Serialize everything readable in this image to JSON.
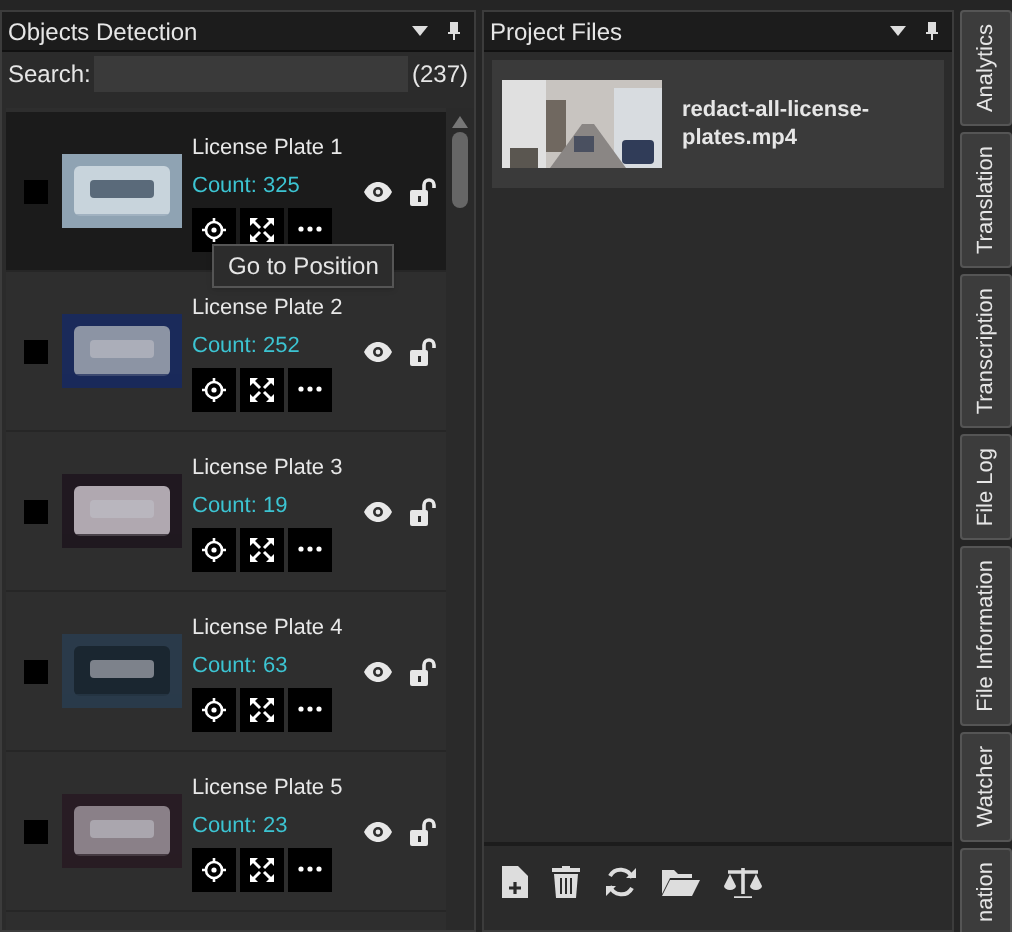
{
  "objects_panel": {
    "title": "Objects Detection",
    "search": {
      "label": "Search:",
      "count": "(237)"
    },
    "items": [
      {
        "name": "License Plate 1",
        "count": "Count: 325",
        "checked": false,
        "selected": true
      },
      {
        "name": "License Plate 2",
        "count": "Count: 252",
        "checked": false,
        "selected": false
      },
      {
        "name": "License Plate 3",
        "count": "Count: 19",
        "checked": false,
        "selected": false
      },
      {
        "name": "License Plate 4",
        "count": "Count: 63",
        "checked": false,
        "selected": false
      },
      {
        "name": "License Plate 5",
        "count": "Count: 23",
        "checked": false,
        "selected": false
      }
    ],
    "tooltip": "Go to Position"
  },
  "files_panel": {
    "title": "Project Files",
    "files": [
      {
        "name": "redact-all-license-plates.mp4"
      }
    ]
  },
  "side_tabs": [
    {
      "label": "Analytics"
    },
    {
      "label": "Translation"
    },
    {
      "label": "Transcription"
    },
    {
      "label": "File Log"
    },
    {
      "label": "File Information"
    },
    {
      "label": "Watcher"
    },
    {
      "label": "nation"
    }
  ]
}
